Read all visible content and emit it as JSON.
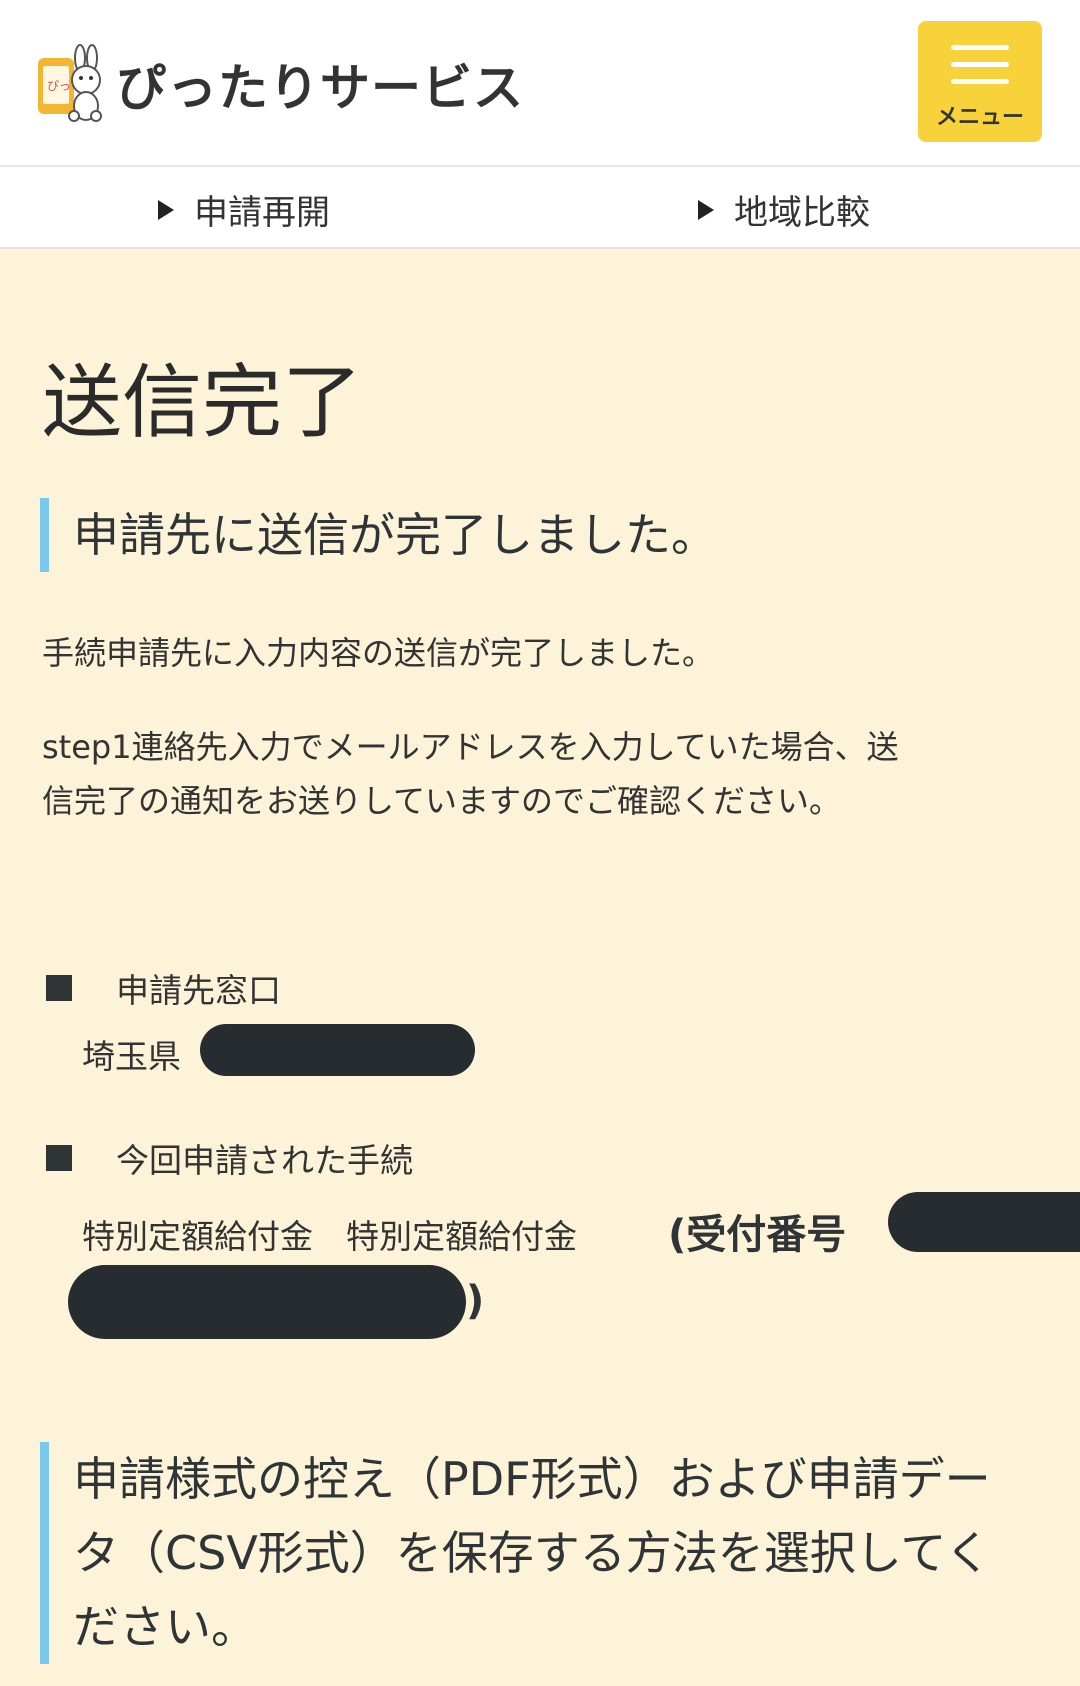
{
  "header": {
    "logo_text": "ぴったりサービス",
    "logo_icon": "rabbit-phone-logo-icon",
    "menu_label": "メニュー",
    "menu_icon": "hamburger-icon"
  },
  "subnav": {
    "items": [
      {
        "label": "申請再開",
        "icon": "triangle-right-icon"
      },
      {
        "label": "地域比較",
        "icon": "triangle-right-icon"
      }
    ]
  },
  "main": {
    "title": "送信完了",
    "heading": "申請先に送信が完了しました。",
    "paragraph1": "手続申請先に入力内容の送信が完了しました。",
    "paragraph2_line1": "step1連絡先入力でメールアドレスを入力していた場合、送",
    "paragraph2_line2": "信完了の通知をお送りしていますのでご確認ください。",
    "destination": {
      "label": "申請先窓口",
      "value": "埼玉県"
    },
    "procedure": {
      "label": "今回申請された手続",
      "value": "特別定額給付金　特別定額給付金",
      "receipt_prefix": "(受付番号",
      "receipt_suffix": ")"
    },
    "save_heading_line1": "申請様式の控え（PDF形式）および申請デー",
    "save_heading_line2": "タ（CSV形式）を保存する方法を選択してく",
    "save_heading_line3": "ださい。"
  },
  "colors": {
    "background": "#fcf3d8",
    "accent_bar": "#7ac9ea",
    "menu_button": "#f7d23b",
    "redaction": "#272c30"
  }
}
